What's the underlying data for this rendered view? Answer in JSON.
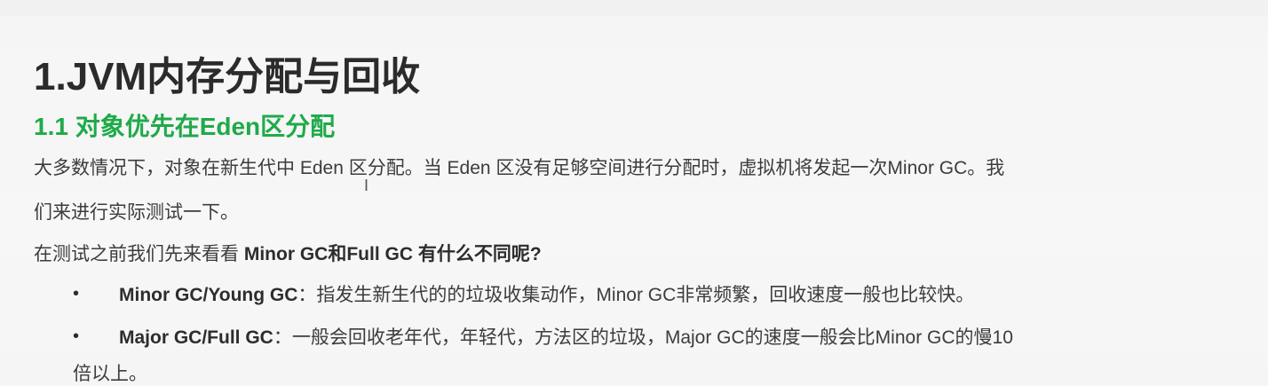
{
  "heading": "1.JVM内存分配与回收",
  "subheading": "1.1 对象优先在Eden区分配",
  "paragraph1": {
    "line1": "大多数情况下，对象在新生代中 Eden 区分配。当 Eden 区没有足够空间进行分配时，虚拟机将发起一次Minor GC。我",
    "line2": "们来进行实际测试一下。"
  },
  "paragraph2": {
    "prefix": "在测试之前我们先来看看 ",
    "bold": "Minor GC和Full GC 有什么不同呢?"
  },
  "bullets": [
    {
      "marker": "•",
      "term": "Minor GC/Young GC",
      "text": "：指发生新生代的的垃圾收集动作，Minor GC非常频繁，回收速度一般也比较快。"
    },
    {
      "marker": "•",
      "term": "Major GC/Full GC",
      "text": "：一般会回收老年代，年轻代，方法区的垃圾，Major GC的速度一般会比Minor GC的慢10",
      "continuation": "倍以上。"
    }
  ],
  "cursor_glyph": "I"
}
